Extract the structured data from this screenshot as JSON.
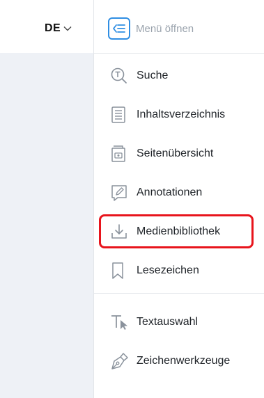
{
  "language": {
    "label": "DE",
    "icon": "chevron-down-icon"
  },
  "menu_toggle": {
    "label": "Menü öffnen",
    "icon": "menu-open-icon",
    "accent": "#2f8ee3"
  },
  "items": [
    {
      "label": "Suche",
      "icon": "search-text-icon"
    },
    {
      "label": "Inhaltsverzeichnis",
      "icon": "table-of-contents-icon"
    },
    {
      "label": "Seitenübersicht",
      "icon": "page-overview-icon"
    },
    {
      "label": "Annotationen",
      "icon": "annotation-icon"
    },
    {
      "label": "Medienbibliothek",
      "icon": "download-media-icon",
      "highlighted": true
    },
    {
      "label": "Lesezeichen",
      "icon": "bookmark-icon"
    },
    {
      "label": "Textauswahl",
      "icon": "text-select-icon"
    },
    {
      "label": "Zeichenwerkzeuge",
      "icon": "pen-icon"
    }
  ],
  "colors": {
    "highlight_border": "#e8141c",
    "left_panel": "#eef1f6",
    "icon_gray": "#8a929c"
  }
}
